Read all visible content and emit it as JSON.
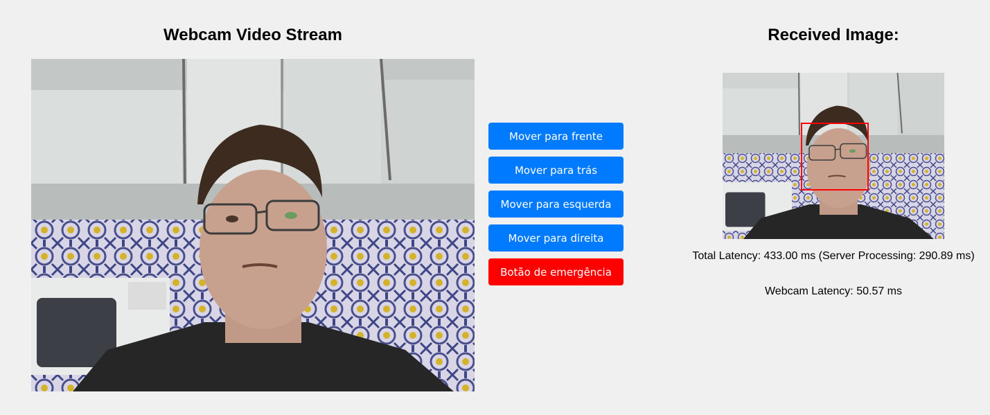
{
  "webcam_panel": {
    "title": "Webcam Video Stream"
  },
  "received_panel": {
    "title": "Received Image:",
    "detection_box_color": "#ff0000"
  },
  "controls": {
    "forward_label": "Mover para frente",
    "back_label": "Mover para trás",
    "left_label": "Mover para esquerda",
    "right_label": "Mover para direita",
    "emergency_label": "Botão de emergência",
    "primary_color": "#007bff",
    "emergency_color": "#ff0000"
  },
  "stats": {
    "total_latency": "Total Latency: 433.00 ms (Server Processing: 290.89 ms)",
    "webcam_latency": "Webcam Latency: 50.57 ms"
  }
}
